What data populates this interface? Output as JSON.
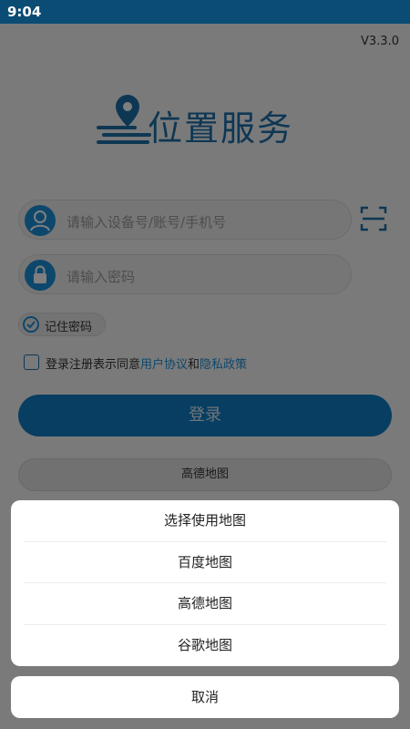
{
  "status_bar": {
    "time": "9:04"
  },
  "app": {
    "version": "V3.3.0",
    "logo_text": "位置服务",
    "account_placeholder": "请输入设备号/账号/手机号",
    "password_placeholder": "请输入密码",
    "remember_label": "记住密码",
    "agreement": {
      "prefix": "登录注册表示同意",
      "user_agreement": "用户协议",
      "and": "和",
      "privacy_policy": "隐私政策"
    },
    "login_label": "登录",
    "map_select_label": "高德地图"
  },
  "action_sheet": {
    "title": "选择使用地图",
    "options": [
      "百度地图",
      "高德地图",
      "谷歌地图"
    ],
    "cancel_label": "取消"
  },
  "colors": {
    "status_bar": "#0a4c74",
    "accent": "#1d8fd8",
    "login_button": "#0f7cc4"
  }
}
